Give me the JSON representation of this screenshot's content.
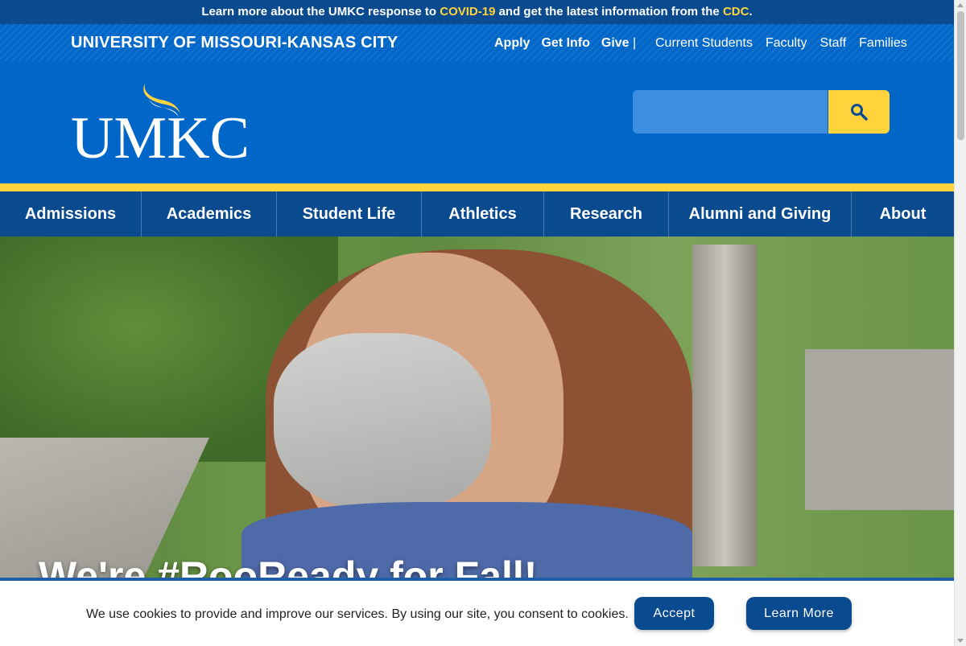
{
  "alert": {
    "text_before": "Learn more about the UMKC response to ",
    "link_covid": "COVID-19",
    "text_middle": " and get the latest information from the ",
    "link_cdc": "CDC",
    "text_end": "."
  },
  "header": {
    "site_name": "UNIVERSITY OF MISSOURI-KANSAS CITY",
    "utility_primary": [
      "Apply",
      "Get Info",
      "Give"
    ],
    "separator": "|",
    "utility_secondary": [
      "Current Students",
      "Faculty",
      "Staff",
      "Families"
    ],
    "logo_text": "UMKC",
    "search": {
      "placeholder": "",
      "icon": "search-icon"
    }
  },
  "main_nav": [
    "Admissions",
    "Academics",
    "Student Life",
    "Athletics",
    "Research",
    "Alumni and Giving",
    "About"
  ],
  "hero": {
    "title": "We're #RooReady for Fall!"
  },
  "cookie_banner": {
    "text": "We use cookies to provide and improve our services. By using our site, you consent to cookies.",
    "accept_label": "Accept",
    "learn_more_label": "Learn More"
  },
  "colors": {
    "brand_blue": "#0066c8",
    "dark_blue": "#0a4b8f",
    "gold": "#ffd33c"
  }
}
